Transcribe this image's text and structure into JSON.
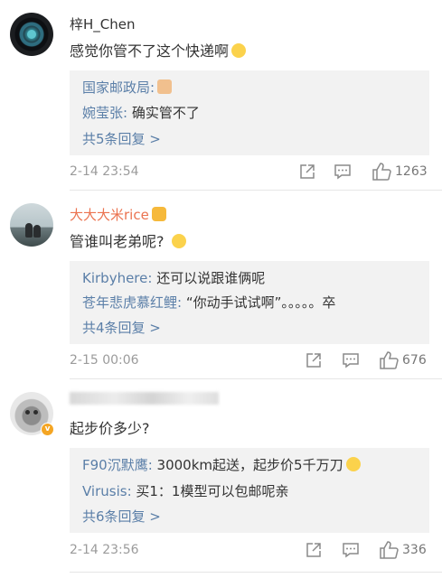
{
  "comments": [
    {
      "username": "梓H_Chen",
      "text": "感觉你管不了这个快递啊",
      "replies": [
        {
          "user": "国家邮政局:",
          "text": ""
        },
        {
          "user": "婉莹张:",
          "text": " 确实管不了"
        }
      ],
      "more_label": "共5条回复 >",
      "time": "2-14 23:54",
      "like_count": "1263"
    },
    {
      "username": "大大大米rice",
      "text": "管谁叫老弟呢?",
      "replies": [
        {
          "user": "Kirbyhere:",
          "text": " 还可以说跟谁俩呢"
        },
        {
          "user": "苍年悲虎慕红鲤:",
          "text": " “你动手试试啊”。。。。。卒"
        }
      ],
      "more_label": "共4条回复 >",
      "time": "2-15 00:06",
      "like_count": "676"
    },
    {
      "username": "",
      "text": "起步价多少?",
      "replies": [
        {
          "user": "F90沉默鹰:",
          "text": " 3000km起送，起步价5千万刀"
        },
        {
          "user": "Virusis:",
          "text": " 买1：1模型可以包邮呢亲"
        }
      ],
      "more_label": "共6条回复 >",
      "time": "2-14 23:56",
      "like_count": "336"
    }
  ],
  "verified_badge": "v",
  "icons": [
    "share-icon",
    "comment-icon",
    "like-icon"
  ],
  "colors": {
    "link": "#5b7fa8",
    "vip_name": "#eb7350",
    "reply_bg": "#f2f2f2",
    "meta": "#9b9b9b"
  }
}
